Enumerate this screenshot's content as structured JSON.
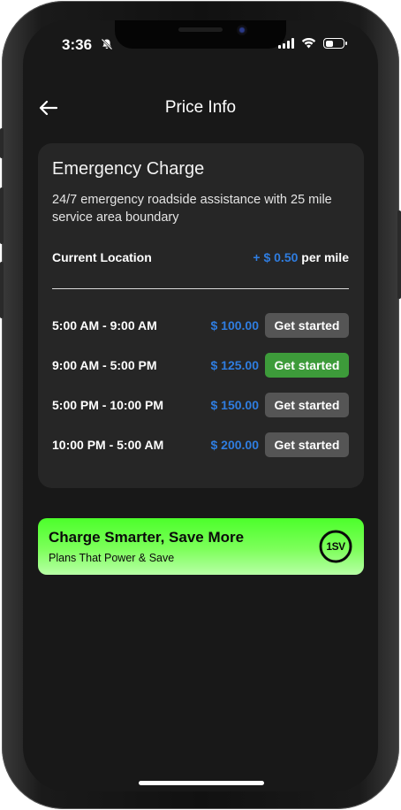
{
  "status_bar": {
    "time": "3:36",
    "icons": [
      "bell-slash-icon",
      "cellular-signal-icon",
      "wifi-icon",
      "battery-icon"
    ]
  },
  "header": {
    "back_icon": "arrow-left-icon",
    "title": "Price Info"
  },
  "card": {
    "title": "Emergency Charge",
    "description": "24/7 emergency roadside assistance with 25 mile service area boundary",
    "location": {
      "label": "Current Location",
      "price": "+ $ 0.50",
      "unit": "per mile"
    },
    "slots": [
      {
        "time": "5:00 AM - 9:00 AM",
        "price": "$ 100.00",
        "button": "Get started",
        "active": false
      },
      {
        "time": "9:00 AM - 5:00 PM",
        "price": "$ 125.00",
        "button": "Get started",
        "active": true
      },
      {
        "time": "5:00 PM - 10:00 PM",
        "price": "$ 150.00",
        "button": "Get started",
        "active": false
      },
      {
        "time": "10:00 PM - 5:00 AM",
        "price": "$ 200.00",
        "button": "Get started",
        "active": false
      }
    ]
  },
  "promo": {
    "title": "Charge Smarter, Save More",
    "subtitle": "Plans That Power & Save",
    "logo_text": "1SV"
  },
  "colors": {
    "screen_bg": "#181818",
    "card_bg": "#262626",
    "price_blue": "#2f7de0",
    "button_gray": "#555555",
    "button_green": "#3d9b3a",
    "promo_green": "#4cff2b"
  }
}
